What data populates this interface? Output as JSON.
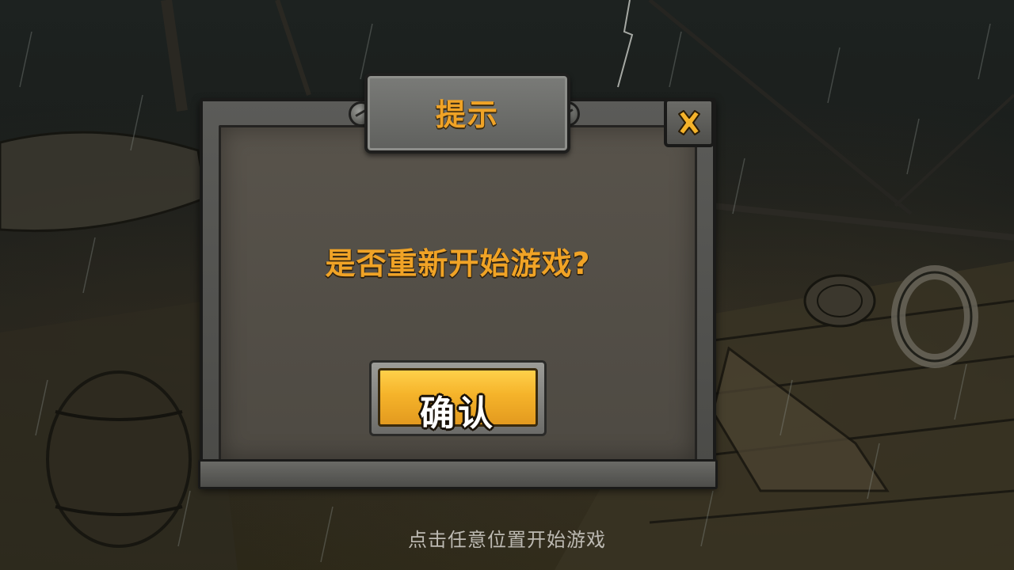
{
  "dialog": {
    "title": "提示",
    "message": "是否重新开始游戏?",
    "confirm_label": "确认",
    "close_glyph": "×"
  },
  "footer": {
    "hint": "点击任意位置开始游戏"
  },
  "colors": {
    "accent_text": "#f0a326",
    "confirm_button": "#f5b32a",
    "panel": "#4e4a43",
    "frame": "#5b5b58"
  },
  "icons": {
    "close": "close-icon",
    "rivet": "rivet-icon"
  }
}
